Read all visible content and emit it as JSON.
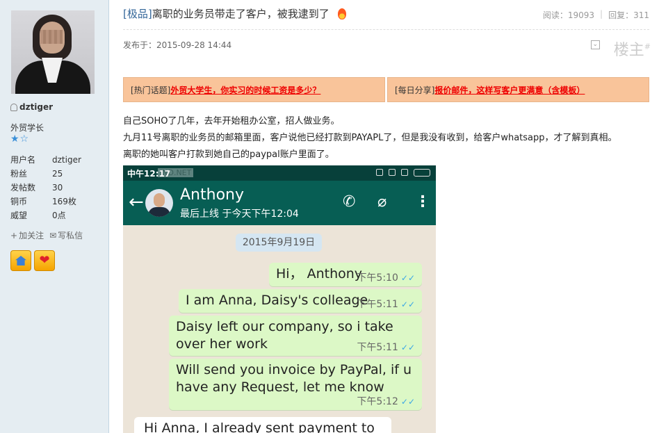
{
  "sidebar": {
    "username": "dztiger",
    "rank": "外贸学长",
    "stars": "★☆",
    "stats": [
      {
        "label": "用户名",
        "value": "dztiger"
      },
      {
        "label": "粉丝",
        "value": "25"
      },
      {
        "label": "发帖数",
        "value": "30"
      },
      {
        "label": "铜币",
        "value": "169枚"
      },
      {
        "label": "威望",
        "value": "0点"
      }
    ],
    "follow_label": "加关注",
    "message_label": "写私信",
    "medals": [
      "house-medal",
      "heart-medal"
    ]
  },
  "post": {
    "tag": "[极品]",
    "title": "离职的业务员带走了客户，被我逮到了",
    "views_label": "阅读：19093",
    "replies_label": "回复：311",
    "posted_label": "发布于：2015-09-28 14:44",
    "floor_label": "楼主",
    "floor_sup": "#",
    "banner1_prefix": "[热门话题]",
    "banner1_link": "外贸大学生，你实习的时候工资是多少？",
    "banner2_prefix": "[每日分享]",
    "banner2_link": "报价邮件，这样写客户更满意（含模板）",
    "lines": [
      "自己SOHO了几年，去年开始租办公室，招人做业务。",
      "九月11号离职的业务员的邮箱里面，客户说他已经打款到PAYAPL了，但是我没有收到，给客户whatsapp，才了解到真相。",
      "离职的她叫客户打款到她自己的paypal账户里面了。"
    ]
  },
  "phone": {
    "status_time": "中午12:17",
    "watermark": "IND.NET",
    "contact_name": "Anthony",
    "contact_status": "最后上线 于今天下午12:04",
    "date_chip": "2015年9月19日",
    "messages": [
      {
        "text": "Hi， Anthony",
        "time": "下午5:10"
      },
      {
        "text": "I am Anna, Daisy's colleage",
        "time": "下午5:11"
      },
      {
        "text": "Daisy left our company, so i take over her work",
        "time": "下午5:11"
      },
      {
        "text": "Will send you invoice by PayPal, if u have any Request, let me know",
        "time": "下午5:12"
      }
    ],
    "incoming_partial": "Hi Anna, I already sent payment to",
    "tick": "✓✓"
  },
  "colors": {
    "sidebar_bg": "#e5edf2",
    "whatsapp_green": "#075e54",
    "bubble_green": "#dcf8c6",
    "banner_bg": "#f9c49a",
    "link_red": "#e00000"
  }
}
